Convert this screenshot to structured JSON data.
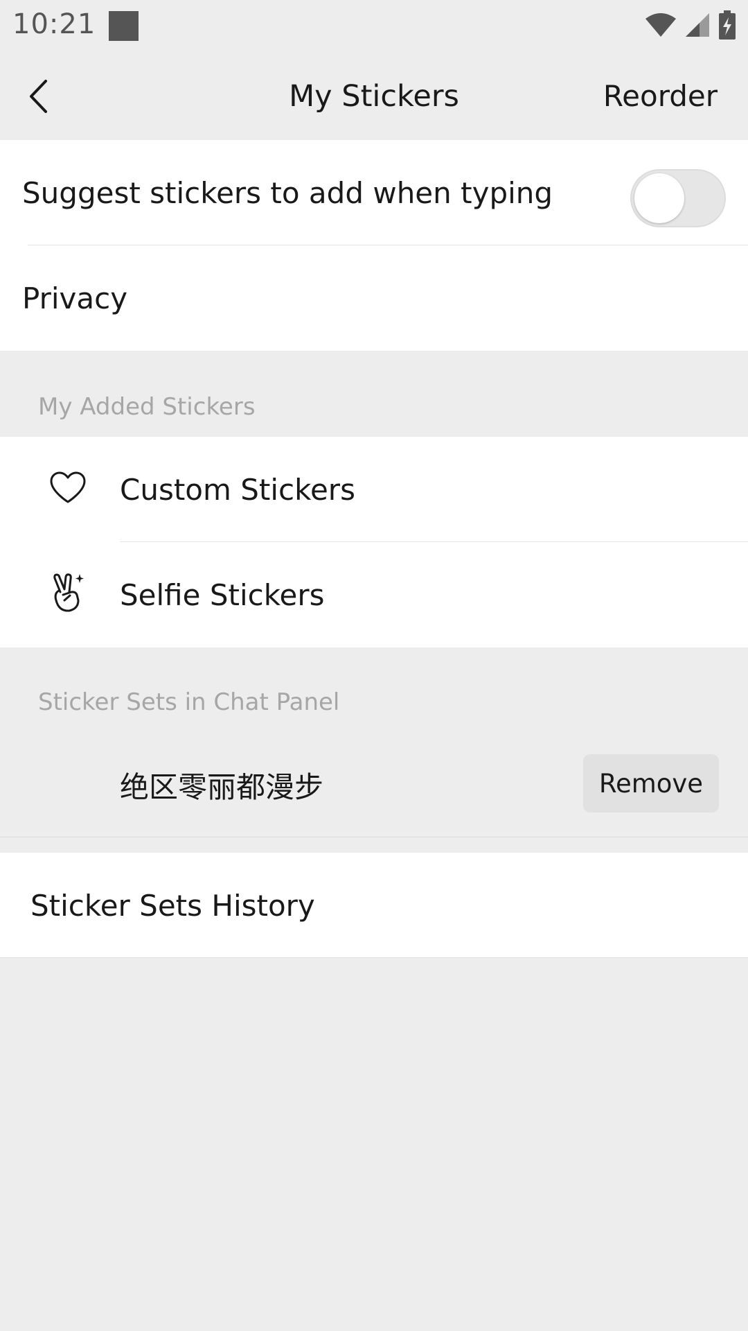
{
  "status_bar": {
    "time": "10:21",
    "icons": [
      "wifi-icon",
      "signal-icon",
      "battery-charging-icon"
    ]
  },
  "nav": {
    "title": "My Stickers",
    "reorder_label": "Reorder",
    "back_icon": "chevron-left-icon"
  },
  "settings": {
    "suggest_label": "Suggest stickers to add when typing",
    "suggest_enabled": false,
    "privacy_label": "Privacy"
  },
  "added": {
    "header": "My Added Stickers",
    "items": [
      {
        "label": "Custom Stickers",
        "icon": "heart-icon"
      },
      {
        "label": "Selfie Stickers",
        "icon": "peace-hand-icon"
      }
    ]
  },
  "chat_panel": {
    "header": "Sticker Sets in Chat Panel",
    "sets": [
      {
        "name": "绝区零丽都漫步",
        "action": "Remove"
      }
    ]
  },
  "history": {
    "label": "Sticker Sets History"
  },
  "colors": {
    "background": "#ededed",
    "card": "#ffffff",
    "text": "#191919",
    "secondary_text": "#a6a6a6"
  }
}
